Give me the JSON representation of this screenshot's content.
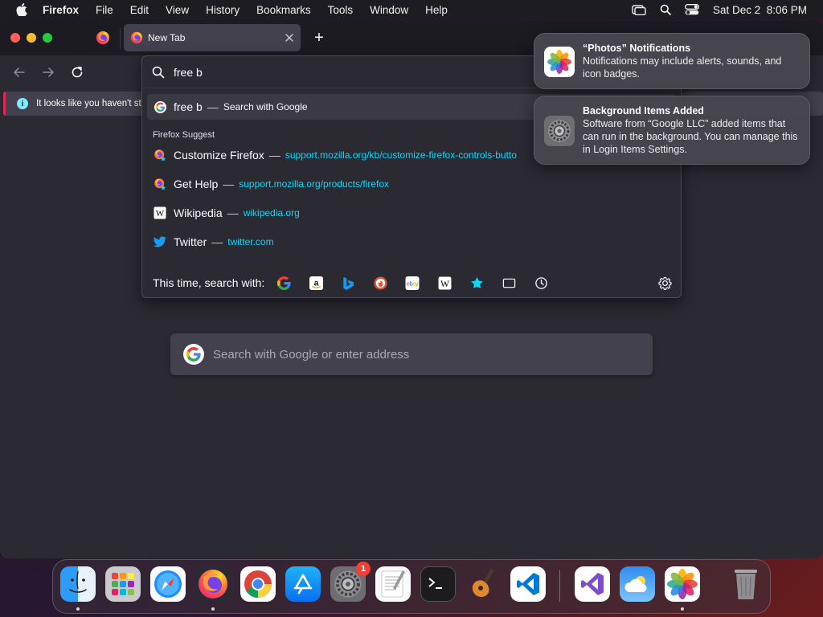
{
  "menubar": {
    "app_name": "Firefox",
    "items": [
      "File",
      "Edit",
      "View",
      "History",
      "Bookmarks",
      "Tools",
      "Window",
      "Help"
    ],
    "datetime": "Sat Dec 2  8:06 PM"
  },
  "browser": {
    "active_tab_title": "New Tab",
    "new_tab_symbol": "+",
    "infobar_text": "It looks like you haven't st",
    "content_search_placeholder": "Search with Google or enter address"
  },
  "urlbar": {
    "query": "free b",
    "search_result": {
      "title": "free b",
      "separator": "—",
      "action": "Search with Google"
    },
    "suggest_heading": "Firefox Suggest",
    "suggestions": [
      {
        "title": "Customize Firefox",
        "separator": "—",
        "url": "support.mozilla.org/kb/customize-firefox-controls-butto",
        "icon": "firefox-suggest-icon"
      },
      {
        "title": "Get Help",
        "separator": "—",
        "url": "support.mozilla.org/products/firefox",
        "icon": "firefox-suggest-icon"
      },
      {
        "title": "Wikipedia",
        "separator": "—",
        "url": "wikipedia.org",
        "icon": "wikipedia-icon"
      },
      {
        "title": "Twitter",
        "separator": "—",
        "url": "twitter.com",
        "icon": "twitter-icon"
      }
    ],
    "oneoff_label": "This time, search with:",
    "engines": [
      "google-icon",
      "amazon-icon",
      "bing-icon",
      "duckduckgo-icon",
      "ebay-icon",
      "wikipedia-icon",
      "bookmarks-star-icon",
      "tabs-icon",
      "history-clock-icon"
    ]
  },
  "notifications": [
    {
      "title": "“Photos” Notifications",
      "body": "Notifications may include alerts, sounds, and icon badges.",
      "icon": "photos-icon"
    },
    {
      "title": "Background Items Added",
      "body": "Software from “Google LLC” added items that can run in the background. You can manage this in Login Items Settings.",
      "icon": "system-settings-icon"
    }
  ],
  "dock": {
    "apps": [
      "finder",
      "launchpad",
      "safari",
      "firefox",
      "chrome",
      "app-store",
      "system-settings",
      "textedit",
      "terminal",
      "garageband",
      "vscode",
      "visual-studio",
      "weather",
      "photos",
      "trash"
    ],
    "system_settings_badge": "1"
  },
  "colors": {
    "accent_link": "#00ddff",
    "window_bg": "#2b2a33",
    "tabstrip_bg": "#1c1b22",
    "infobar_accent": "#e22850"
  }
}
